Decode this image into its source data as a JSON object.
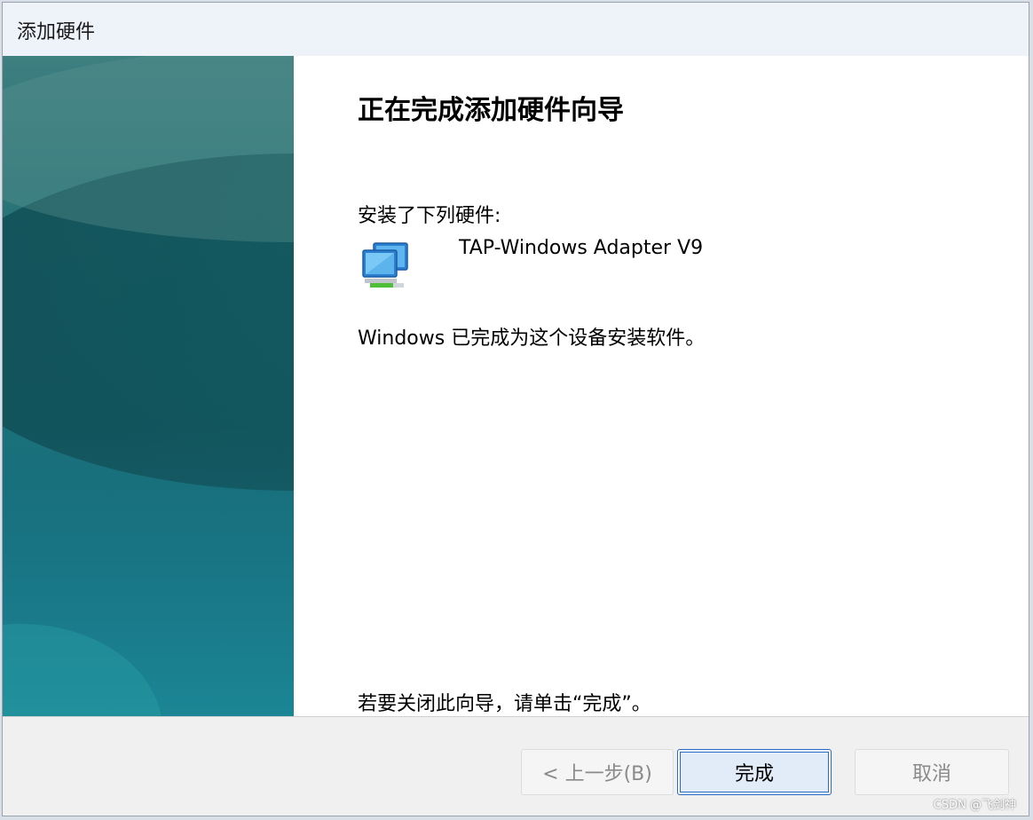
{
  "window": {
    "title": "添加硬件"
  },
  "content": {
    "heading": "正在完成添加硬件向导",
    "installed_label": "安装了下列硬件:",
    "device_name": "TAP-Windows Adapter V9",
    "device_icon": "network-adapter-icon",
    "done_text": "Windows 已完成为这个设备安装软件。",
    "close_hint": "若要关闭此向导，请单击“完成”。"
  },
  "buttons": {
    "back_label": "< 上一步(B)",
    "finish_label": "完成",
    "cancel_label": "取消"
  },
  "watermark": "CSDN @飞剑神",
  "colors": {
    "side_panel": "#1f6f74",
    "accent_border": "#2c6bc4",
    "disabled_text": "#8a8a8a"
  }
}
